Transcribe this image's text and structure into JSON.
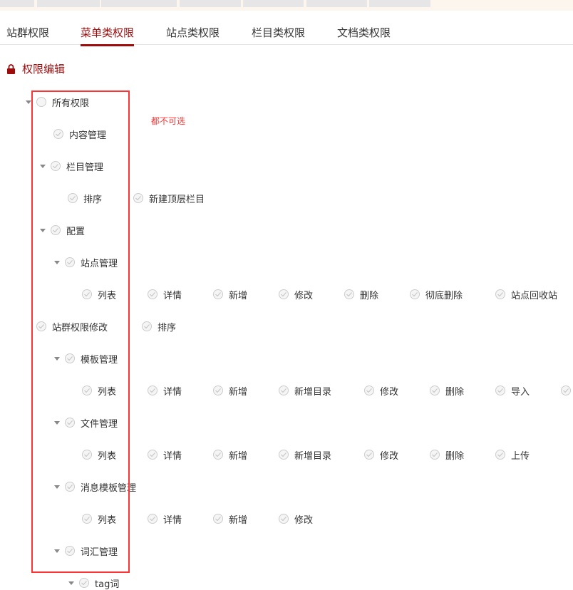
{
  "tabs": [
    {
      "label": "站群权限"
    },
    {
      "label": "菜单类权限",
      "active": true
    },
    {
      "label": "站点类权限"
    },
    {
      "label": "栏目类权限"
    },
    {
      "label": "文档类权限"
    }
  ],
  "section": {
    "icon": "lock-icon",
    "title": "权限编辑"
  },
  "note": "都不可选",
  "colors": {
    "accent": "#9d0b0b",
    "annotation": "#ff3333"
  },
  "tree": [
    {
      "toggle": true,
      "items": [
        "所有权限"
      ]
    },
    {
      "toggle": false,
      "items": [
        "内容管理"
      ]
    },
    {
      "toggle": true,
      "items": [
        "栏目管理"
      ]
    },
    {
      "toggle": false,
      "items": [
        "排序",
        "新建顶层栏目"
      ]
    },
    {
      "toggle": true,
      "items": [
        "配置"
      ]
    },
    {
      "toggle": true,
      "items": [
        "站点管理"
      ]
    },
    {
      "toggle": false,
      "items": [
        "列表",
        "详情",
        "新增",
        "修改",
        "删除",
        "彻底删除",
        "站点回收站"
      ]
    },
    {
      "toggle": false,
      "items": [
        "站群权限修改",
        "排序"
      ]
    },
    {
      "toggle": true,
      "items": [
        "模板管理"
      ]
    },
    {
      "toggle": false,
      "items": [
        "列表",
        "详情",
        "新增",
        "新增目录",
        "修改",
        "删除",
        "导入",
        ""
      ]
    },
    {
      "toggle": true,
      "items": [
        "文件管理"
      ]
    },
    {
      "toggle": false,
      "items": [
        "列表",
        "详情",
        "新增",
        "新增目录",
        "修改",
        "删除",
        "上传"
      ]
    },
    {
      "toggle": true,
      "items": [
        "消息模板管理"
      ]
    },
    {
      "toggle": false,
      "items": [
        "列表",
        "详情",
        "新增",
        "修改"
      ]
    },
    {
      "toggle": true,
      "items": [
        "词汇管理"
      ]
    },
    {
      "toggle": true,
      "items": [
        "tag词"
      ]
    }
  ]
}
